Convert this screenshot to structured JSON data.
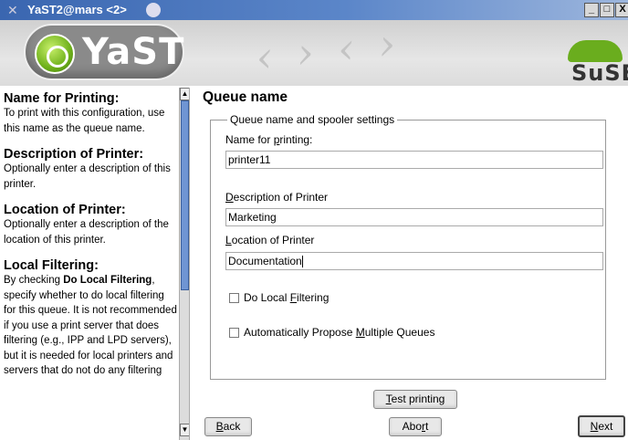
{
  "window": {
    "title": "YaST2@mars <2>",
    "buttons": [
      "_",
      "□",
      "X"
    ]
  },
  "banner": {
    "yast_logo_text": "YaST",
    "suse_logo_text": "SuSE"
  },
  "help": {
    "sections": [
      {
        "title": "Name for Printing:",
        "text": "To print with this configuration, use this name as the queue name."
      },
      {
        "title": "Description of Printer:",
        "text": "Optionally enter a description of this printer."
      },
      {
        "title": "Location of Printer:",
        "text": "Optionally enter a description of the location of this printer."
      },
      {
        "title": "Local Filtering:",
        "text_pre": "By checking ",
        "text_bold": "Do Local Filtering",
        "text_post": ", specify whether to do local filtering for this queue. It is not recommended if you use a print server that does filtering (e.g., IPP and LPD servers), but it is needed for local printers and servers that do not do any filtering"
      }
    ]
  },
  "main": {
    "heading": "Queue name",
    "group_title": "Queue name and spooler settings",
    "fields": [
      {
        "label_pre": "Name for ",
        "label_key": "p",
        "label_post": "rinting:",
        "value": "printer11"
      },
      {
        "label_pre": "",
        "label_key": "D",
        "label_post": "escription of Printer",
        "value": "Marketing"
      },
      {
        "label_pre": "",
        "label_key": "L",
        "label_post": "ocation of Printer",
        "value": "Documentation"
      }
    ],
    "checkboxes": [
      {
        "label_pre": "Do Local ",
        "label_key": "F",
        "label_post": "iltering",
        "checked": false
      },
      {
        "label_pre": "Automatically Propose ",
        "label_key": "M",
        "label_post": "ultiple Queues",
        "checked": false
      }
    ]
  },
  "buttons": {
    "test_printing": {
      "key": "T",
      "rest": "est printing"
    },
    "back": {
      "key": "B",
      "rest": "ack"
    },
    "abort": {
      "pre": "Abo",
      "key": "r",
      "rest": "t"
    },
    "next": {
      "key": "N",
      "rest": "ext"
    }
  }
}
